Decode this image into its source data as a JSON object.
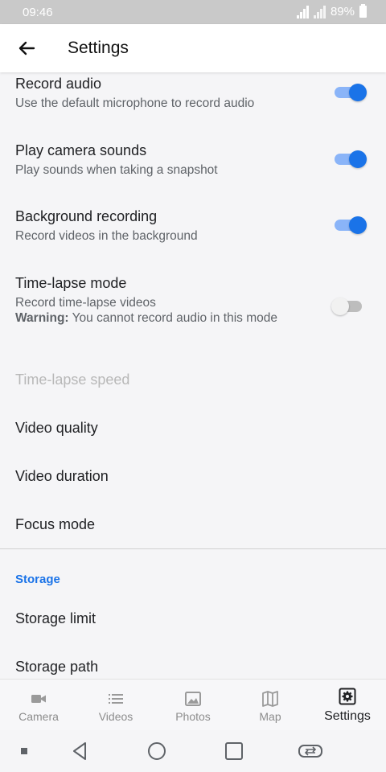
{
  "status": {
    "time": "09:46",
    "battery": "89%"
  },
  "appbar": {
    "title": "Settings"
  },
  "settings": [
    {
      "title": "Record audio",
      "subtitle": "Use the default microphone to record audio",
      "toggle": "on"
    },
    {
      "title": "Play camera sounds",
      "subtitle": "Play sounds when taking a snapshot",
      "toggle": "on"
    },
    {
      "title": "Background recording",
      "subtitle": "Record videos in the background",
      "toggle": "on"
    },
    {
      "title": "Time-lapse mode",
      "subtitle": "Record time-lapse videos",
      "warning_label": "Warning:",
      "warning_text": "You cannot record audio in this mode",
      "toggle": "off"
    },
    {
      "title": "Time-lapse speed",
      "enabled": false
    },
    {
      "title": "Video quality"
    },
    {
      "title": "Video duration"
    },
    {
      "title": "Focus mode"
    }
  ],
  "storage": {
    "header": "Storage",
    "items": [
      {
        "title": "Storage limit"
      },
      {
        "title": "Storage path"
      }
    ]
  },
  "bottom_nav": [
    {
      "label": "Camera",
      "icon": "videocam-icon"
    },
    {
      "label": "Videos",
      "icon": "list-icon"
    },
    {
      "label": "Photos",
      "icon": "image-icon"
    },
    {
      "label": "Map",
      "icon": "map-icon"
    },
    {
      "label": "Settings",
      "icon": "settings-icon",
      "active": true
    }
  ],
  "colors": {
    "accent": "#1a73e8",
    "track_on": "#8ab4f8",
    "text_disabled": "#b8b8b8"
  }
}
